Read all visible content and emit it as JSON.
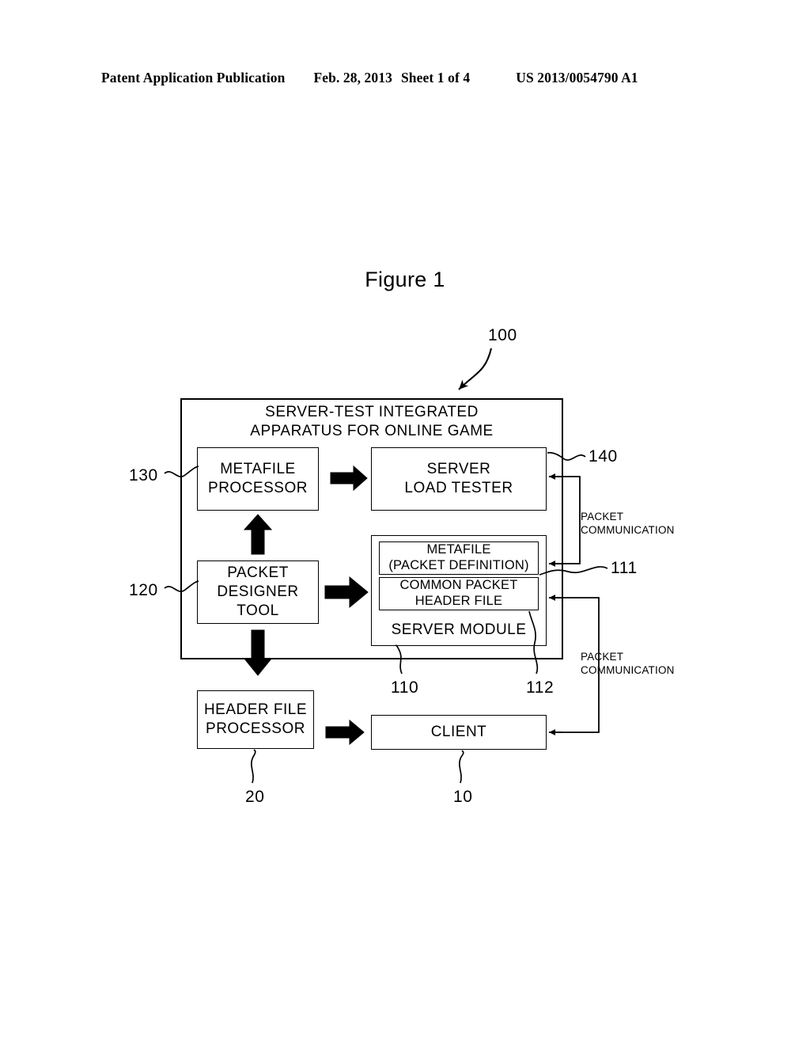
{
  "header": {
    "publication": "Patent Application Publication",
    "date": "Feb. 28, 2013",
    "sheet": "Sheet 1 of 4",
    "number": "US 2013/0054790 A1"
  },
  "figure": {
    "title": "Figure 1",
    "apparatus_ref": "100"
  },
  "diagram": {
    "outer_box": {
      "title": "SERVER-TEST INTEGRATED\nAPPARATUS FOR ONLINE GAME"
    },
    "boxes": [
      {
        "id": "metafile-processor",
        "label": "METAFILE\nPROCESSOR",
        "ref": "130"
      },
      {
        "id": "server-load-tester",
        "label": "SERVER\nLOAD TESTER",
        "ref": "140"
      },
      {
        "id": "packet-designer-tool",
        "label": "PACKET\nDESIGNER TOOL",
        "ref": "120"
      },
      {
        "id": "server-module",
        "label": "SERVER MODULE",
        "ref": "110"
      },
      {
        "id": "metafile",
        "label": "METAFILE\n(PACKET DEFINITION)",
        "ref": "111"
      },
      {
        "id": "common-packet-header",
        "label": "COMMON PACKET\nHEADER FILE",
        "ref": "112"
      },
      {
        "id": "header-file-processor",
        "label": "HEADER FILE\nPROCESSOR",
        "ref": "20"
      },
      {
        "id": "client",
        "label": "CLIENT",
        "ref": "10"
      }
    ],
    "connections": [
      {
        "id": "packet-communication-upper",
        "label": "PACKET\nCOMMUNICATION"
      },
      {
        "id": "packet-communication-lower",
        "label": "PACKET\nCOMMUNICATION"
      }
    ]
  }
}
